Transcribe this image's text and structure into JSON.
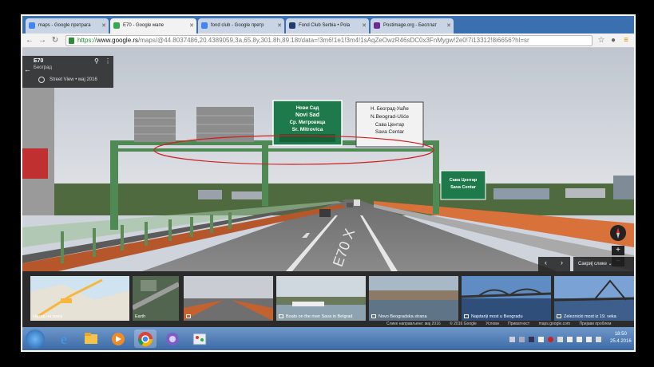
{
  "tabs": [
    {
      "label": "maps - Google претрага",
      "color": "#4285f4"
    },
    {
      "label": "E70 - Google мапе",
      "color": "#34a853"
    },
    {
      "label": "fond club - Google претр",
      "color": "#4285f4"
    },
    {
      "label": "Fond Club Serbia • Pola",
      "color": "#1e3b70"
    },
    {
      "label": "Postimage.org - Бесплат",
      "color": "#6a2c91"
    }
  ],
  "address": {
    "scheme": "https://",
    "host": "www.google.rs",
    "path": "/maps/@44.8037486,20.4389059,3a,65.8y,301.8h,89.18t/data=!3m6!1e1!3m4!1sAqZeOwzR46sDC0x3FnMygw!2e0!7i13312!8i6656?hl=sr"
  },
  "infocard": {
    "title": "E70",
    "subtitle": "Београд",
    "streetview": "Street View • мај 2016"
  },
  "signs": {
    "left": [
      "Нови Сад",
      "Novi Sad",
      "Ср. Митровица",
      "Sr. Mitrovica"
    ],
    "right": [
      "Н. Београд-Ушће",
      "N.Beograd-Ušće",
      "Сава Центар",
      "Sava Centar"
    ],
    "small": [
      "Сава Центар",
      "Sava Centar"
    ],
    "road_marking": "E70 X"
  },
  "controls": {
    "expand_label": "Сакриј слике",
    "zoom_in": "+",
    "zoom_out": "−"
  },
  "thumbnails": [
    {
      "caption": "Назад на мапу",
      "camera": false
    },
    {
      "caption": "Earth",
      "camera": false
    },
    {
      "caption": "",
      "camera": true
    },
    {
      "caption": "Boats on the river Sava in Belgrad",
      "camera": true
    },
    {
      "caption": "Novo Beogradska strana",
      "camera": true
    },
    {
      "caption": "Najstariji most u Beogradu",
      "camera": true
    },
    {
      "caption": "Zeleznicki most iz 19. veka",
      "camera": true
    }
  ],
  "attribution": [
    "Слике направљене: мај 2016",
    "© 2016 Google",
    "Услови",
    "Приватност",
    "maps.google.com",
    "Пријави проблем"
  ],
  "clock": {
    "time": "18:50",
    "date": "25.4.2016"
  }
}
